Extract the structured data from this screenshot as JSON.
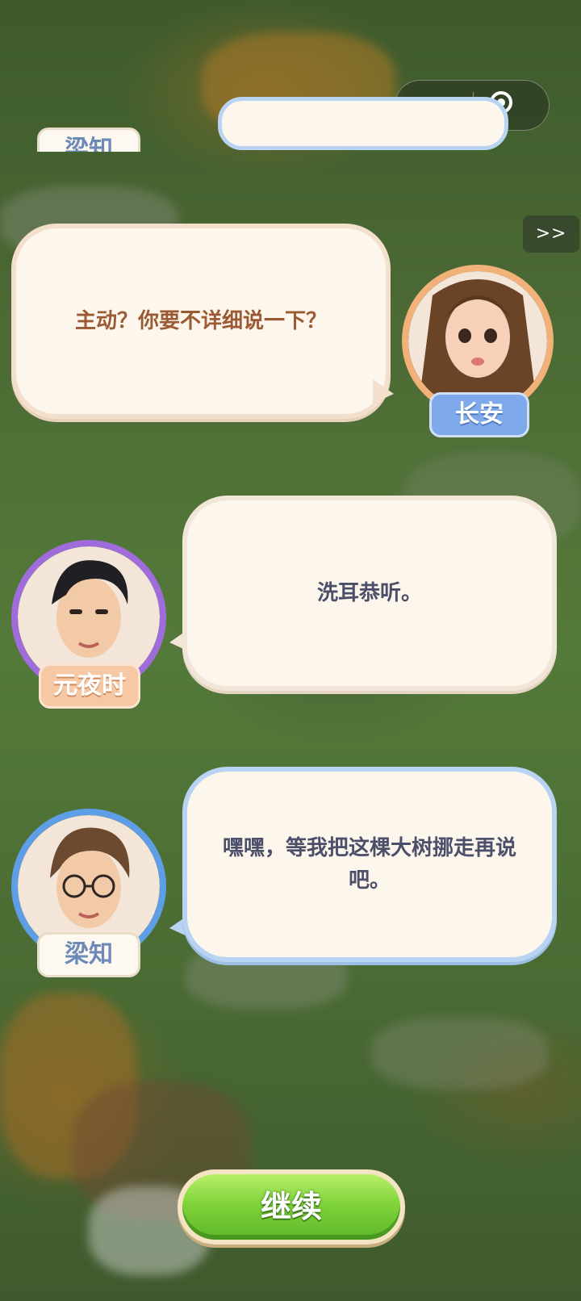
{
  "top_bar": {
    "more_icon": "ellipsis-icon",
    "close_icon": "target-circle-icon"
  },
  "skip_button": {
    "label": ">>"
  },
  "dialogues": [
    {
      "speaker": "梁知",
      "text": "",
      "partial": true
    },
    {
      "speaker": "长安",
      "text": "主动？你要不详细说一下？"
    },
    {
      "speaker": "元夜时",
      "text": "洗耳恭听。"
    },
    {
      "speaker": "梁知",
      "text": "嘿嘿，等我把这棵大树挪走再说吧。"
    }
  ],
  "continue_button": {
    "label": "继续"
  },
  "colors": {
    "changan_ring": "#f2b178",
    "yuanyeshi_ring": "#a06cdc",
    "liangzhi_ring": "#5e9ee6",
    "continue_green": "#7fd33a"
  }
}
